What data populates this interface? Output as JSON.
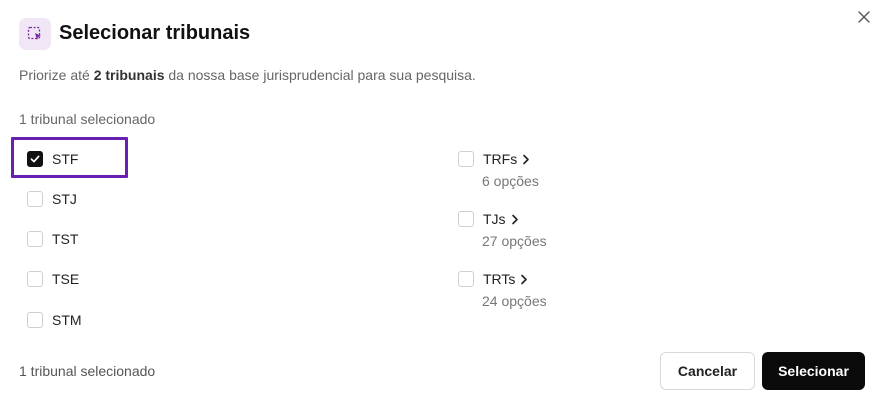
{
  "dialog": {
    "title": "Selecionar tribunais",
    "description_prefix": "Priorize até ",
    "description_bold": "2 tribunais",
    "description_suffix": " da nossa base jurisprudencial para sua pesquisa.",
    "selected_count_top": "1 tribunal selecionado",
    "selected_count_bottom": "1 tribunal selecionado",
    "close_icon": "close-icon",
    "header_icon": "select-icon",
    "accent_color": "#6a1fb0"
  },
  "tribunals": [
    {
      "label": "STF",
      "checked": true
    },
    {
      "label": "STJ",
      "checked": false
    },
    {
      "label": "TST",
      "checked": false
    },
    {
      "label": "TSE",
      "checked": false
    },
    {
      "label": "STM",
      "checked": false
    }
  ],
  "groups": [
    {
      "label": "TRFs",
      "sublabel": "6 opções",
      "checked": false
    },
    {
      "label": "TJs",
      "sublabel": "27 opções",
      "checked": false
    },
    {
      "label": "TRTs",
      "sublabel": "24 opções",
      "checked": false
    }
  ],
  "actions": {
    "cancel_label": "Cancelar",
    "select_label": "Selecionar"
  }
}
